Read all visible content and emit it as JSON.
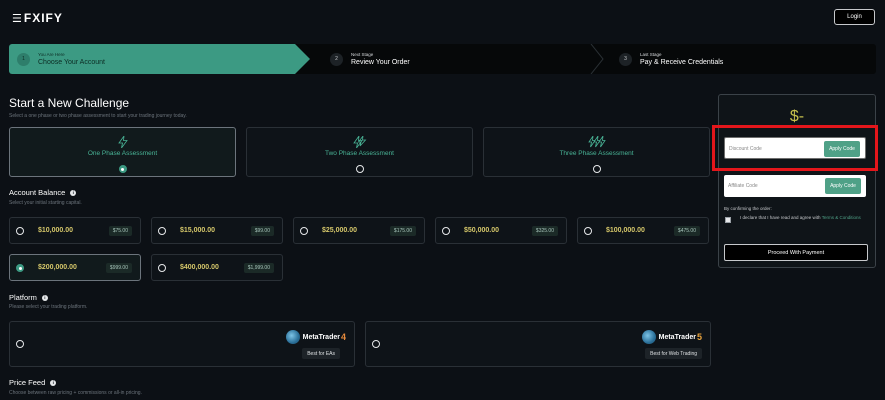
{
  "header": {
    "logo_text": "FXIFY",
    "login_label": "Login"
  },
  "stepper": {
    "steps": [
      {
        "num": "1",
        "small": "You Are Here",
        "big": "Choose Your Account"
      },
      {
        "num": "2",
        "small": "Next Stage",
        "big": "Review Your Order"
      },
      {
        "num": "3",
        "small": "Last Stage",
        "big": "Pay & Receive Credentials"
      }
    ]
  },
  "challenge": {
    "title": "Start a New Challenge",
    "subtitle": "Select a one phase or two phase assessment to start your trading journey today.",
    "phases": [
      {
        "label": "One Phase Assessment",
        "selected": true
      },
      {
        "label": "Two Phase Assessment",
        "selected": false
      },
      {
        "label": "Three Phase Assessment",
        "selected": false
      }
    ]
  },
  "balance": {
    "title": "Account Balance",
    "subtitle": "Select your initial starting capital.",
    "options": [
      {
        "amount": "$10,000.00",
        "price": "$75.00"
      },
      {
        "amount": "$15,000.00",
        "price": "$99.00"
      },
      {
        "amount": "$25,000.00",
        "price": "$175.00"
      },
      {
        "amount": "$50,000.00",
        "price": "$325.00"
      },
      {
        "amount": "$100,000.00",
        "price": "$475.00"
      },
      {
        "amount": "$200,000.00",
        "price": "$999.00"
      },
      {
        "amount": "$400,000.00",
        "price": "$1,999.00"
      }
    ],
    "selected_index": 5
  },
  "platform": {
    "title": "Platform",
    "subtitle": "Please select your trading platform.",
    "options": [
      {
        "name": "MetaTrader",
        "version": "4",
        "badge": "Best for EAs"
      },
      {
        "name": "MetaTrader",
        "version": "5",
        "badge": "Best for Web Trading"
      }
    ]
  },
  "price_feed": {
    "title": "Price Feed",
    "subtitle": "Choose between raw pricing + commissions or all-in pricing."
  },
  "summary": {
    "price": "$-",
    "discount_placeholder": "Discount Code",
    "affiliate_placeholder": "Affiliate Code",
    "apply_label": "Apply Code",
    "confirm_note": "By confirming the order:",
    "terms_prefix": "I declare that I have read and agree with ",
    "terms_link": "Terms & Conditions",
    "proceed_label": "Proceed With Payment"
  },
  "colors": {
    "accent": "#3c9a83",
    "highlight": "#e4161b",
    "price": "#c7c14d"
  }
}
